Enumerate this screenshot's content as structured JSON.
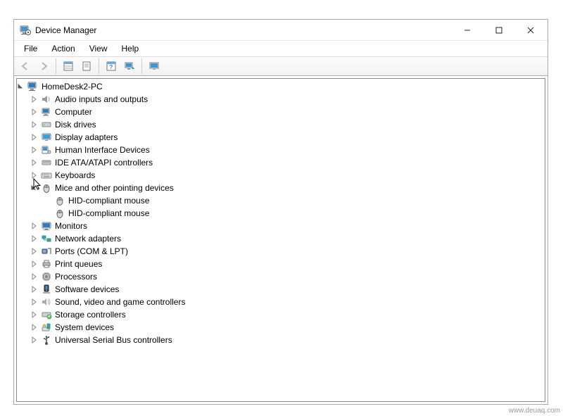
{
  "window": {
    "title": "Device Manager"
  },
  "menu": {
    "file": "File",
    "action": "Action",
    "view": "View",
    "help": "Help"
  },
  "tree": {
    "root": "HomeDesk2-PC",
    "categories": [
      {
        "label": "Audio inputs and outputs",
        "icon": "speaker"
      },
      {
        "label": "Computer",
        "icon": "computer"
      },
      {
        "label": "Disk drives",
        "icon": "disk"
      },
      {
        "label": "Display adapters",
        "icon": "display"
      },
      {
        "label": "Human Interface Devices",
        "icon": "hid"
      },
      {
        "label": "IDE ATA/ATAPI controllers",
        "icon": "ide"
      },
      {
        "label": "Keyboards",
        "icon": "keyboard"
      },
      {
        "label": "Mice and other pointing devices",
        "icon": "mouse",
        "expanded": true,
        "children": [
          {
            "label": "HID-compliant mouse",
            "icon": "mouse"
          },
          {
            "label": "HID-compliant mouse",
            "icon": "mouse"
          }
        ]
      },
      {
        "label": "Monitors",
        "icon": "monitor"
      },
      {
        "label": "Network adapters",
        "icon": "network"
      },
      {
        "label": "Ports (COM & LPT)",
        "icon": "ports"
      },
      {
        "label": "Print queues",
        "icon": "printer"
      },
      {
        "label": "Processors",
        "icon": "processor"
      },
      {
        "label": "Software devices",
        "icon": "software"
      },
      {
        "label": "Sound, video and game controllers",
        "icon": "sound"
      },
      {
        "label": "Storage controllers",
        "icon": "storage"
      },
      {
        "label": "System devices",
        "icon": "system"
      },
      {
        "label": "Universal Serial Bus controllers",
        "icon": "usb"
      }
    ]
  },
  "watermark": "www.deuaq.com"
}
